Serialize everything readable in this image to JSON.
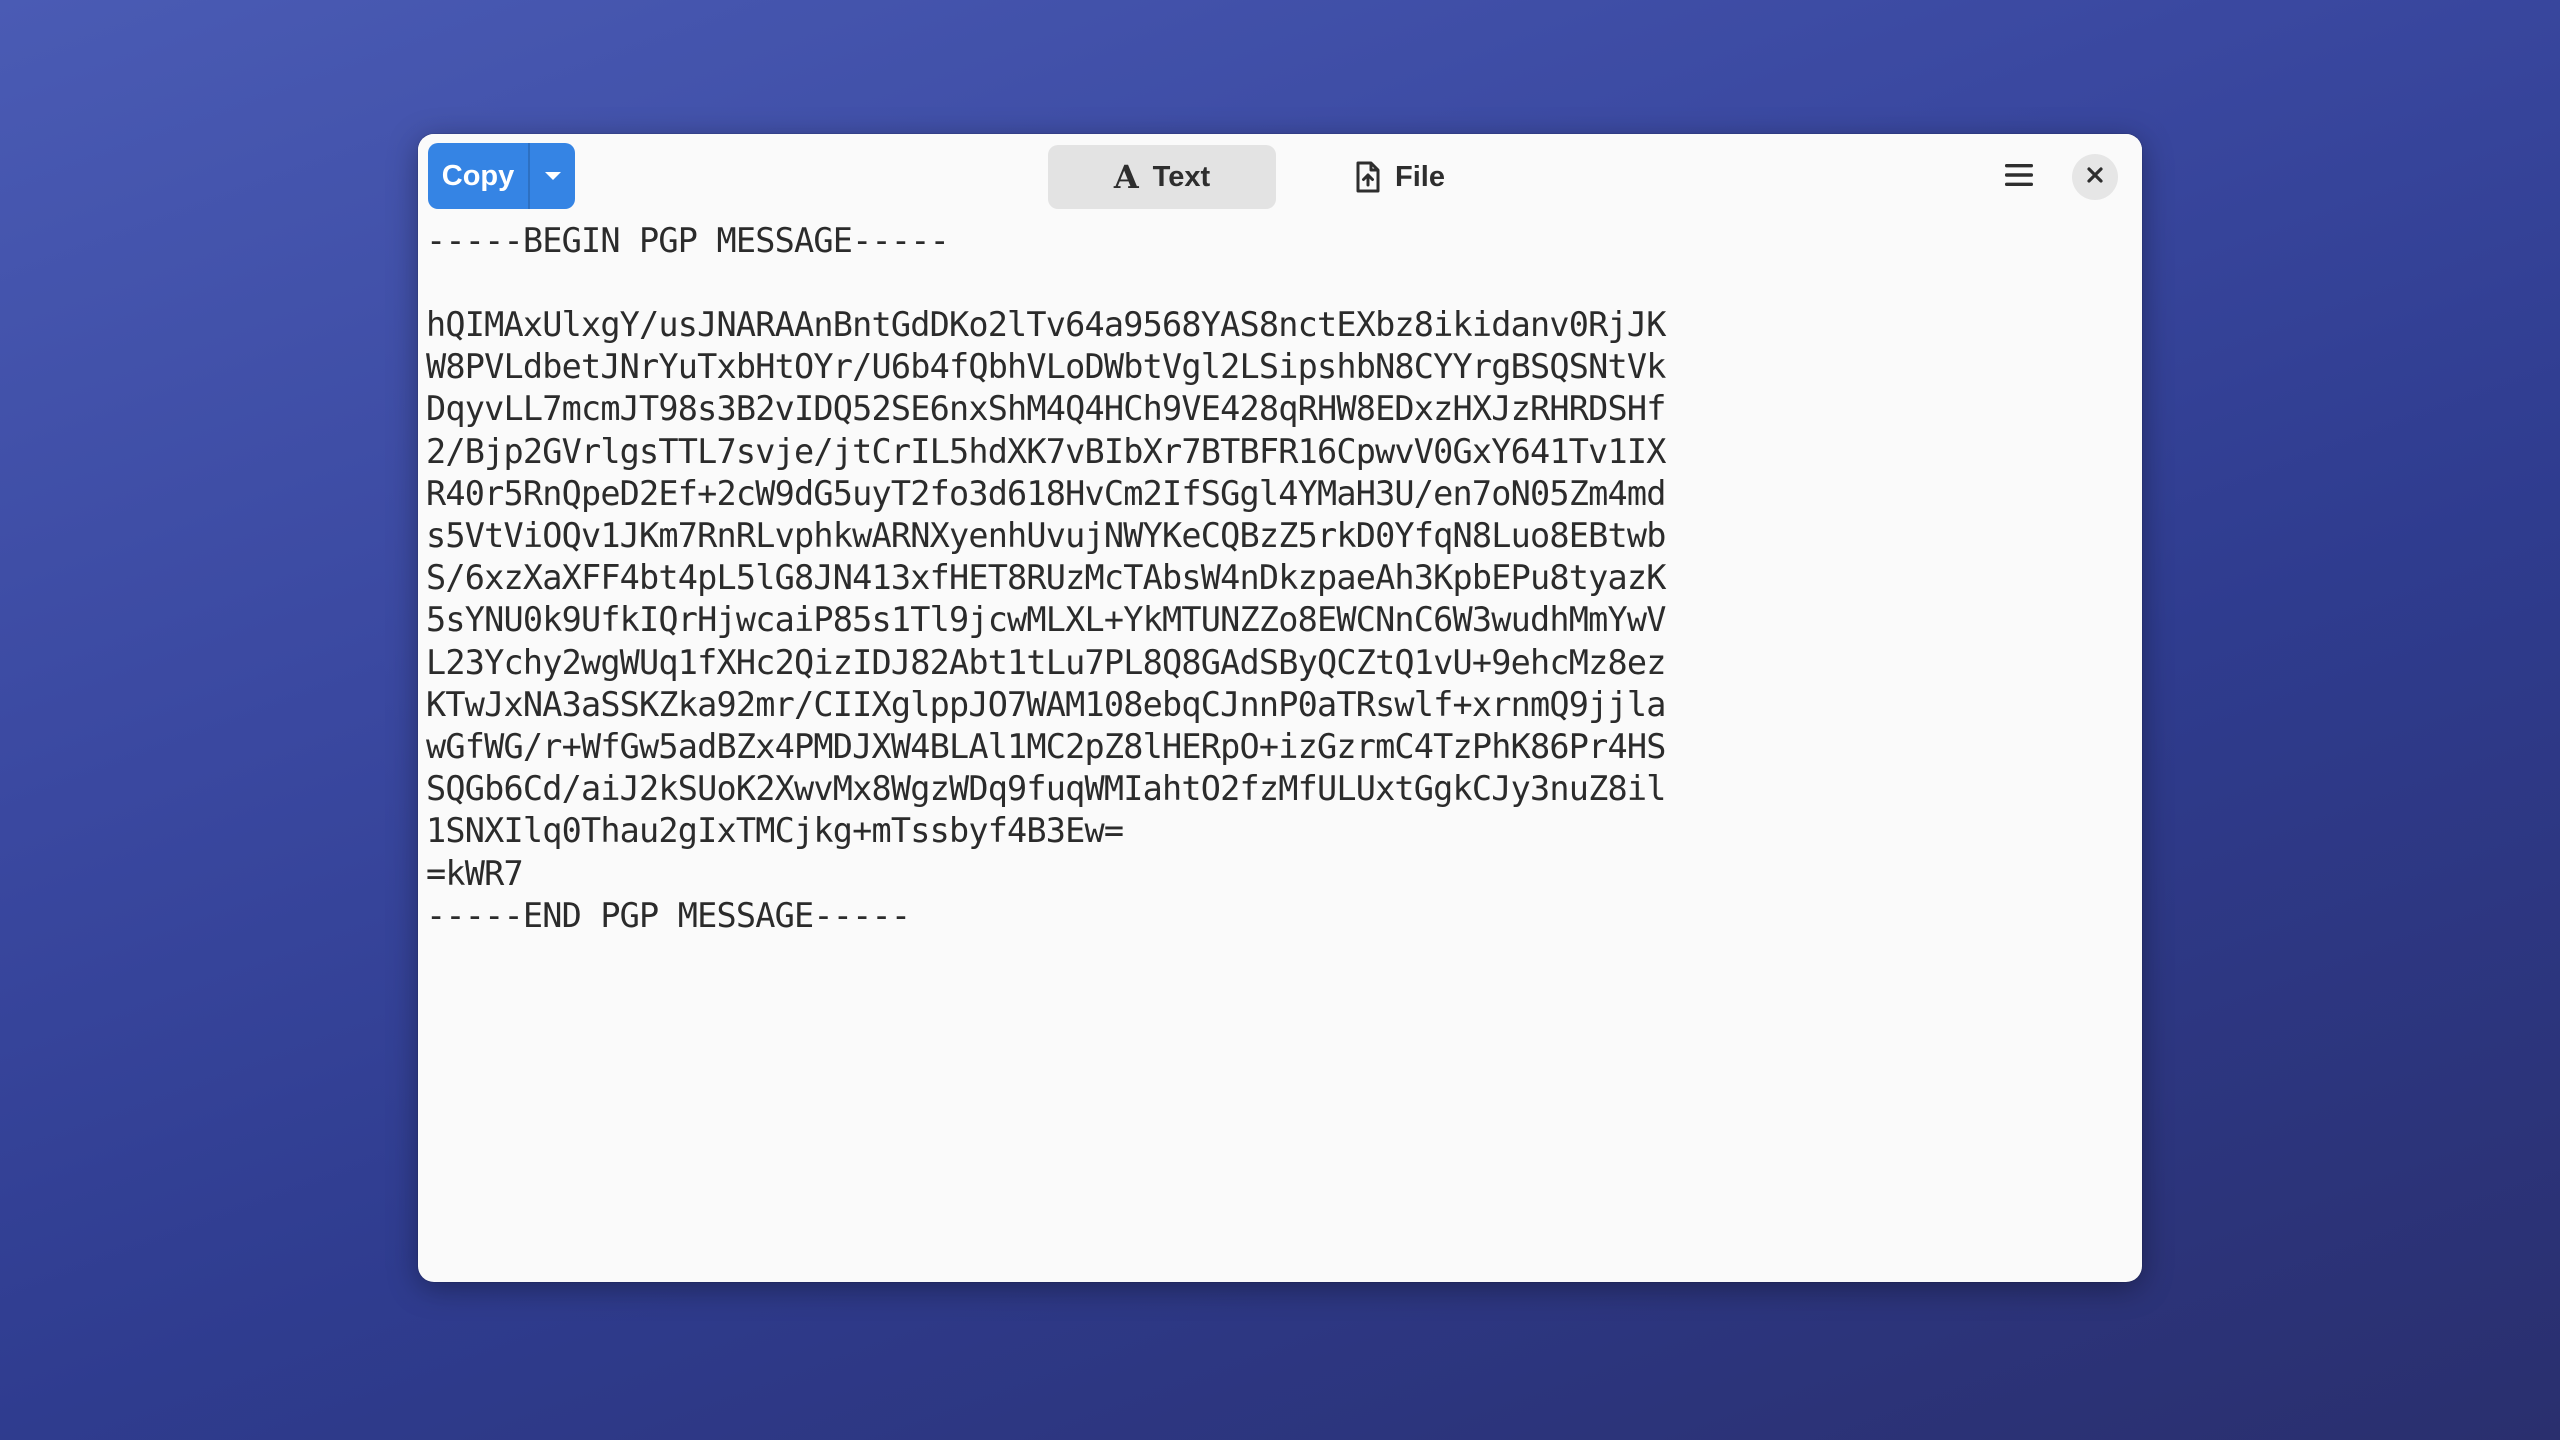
{
  "toolbar": {
    "copy_label": "Copy",
    "modes": [
      {
        "label": "Text",
        "icon": "text-format-icon",
        "active": true
      },
      {
        "label": "File",
        "icon": "document-icon",
        "active": false
      }
    ]
  },
  "message": {
    "header": "-----BEGIN PGP MESSAGE-----",
    "body_lines": [
      "hQIMAxUlxgY/usJNARAAnBntGdDKo2lTv64a9568YAS8nctEXbz8ikidanv0RjJK",
      "W8PVLdbetJNrYuTxbHtOYr/U6b4fQbhVLoDWbtVgl2LSipshbN8CYYrgBSQSNtVk",
      "DqyvLL7mcmJT98s3B2vIDQ52SE6nxShM4Q4HCh9VE428qRHW8EDxzHXJzRHRDSHf",
      "2/Bjp2GVrlgsTTL7svje/jtCrIL5hdXK7vBIbXr7BTBFR16CpwvV0GxY641Tv1IX",
      "R40r5RnQpeD2Ef+2cW9dG5uyT2fo3d618HvCm2IfSGgl4YMaH3U/en7oN05Zm4md",
      "s5VtViOQv1JKm7RnRLvphkwARNXyenhUvujNWYKeCQBzZ5rkD0YfqN8Luo8EBtwb",
      "S/6xzXaXFF4bt4pL5lG8JN413xfHET8RUzMcTAbsW4nDkzpaeAh3KpbEPu8tyazK",
      "5sYNU0k9UfkIQrHjwcaiP85s1Tl9jcwMLXL+YkMTUNZZo8EWCNnC6W3wudhMmYwV",
      "L23Ychy2wgWUq1fXHc2QizIDJ82Abt1tLu7PL8Q8GAdSByQCZtQ1vU+9ehcMz8ez",
      "KTwJxNA3aSSKZka92mr/CIIXglppJO7WAM108ebqCJnnP0aTRswlf+xrnmQ9jjla",
      "wGfWG/r+WfGw5adBZx4PMDJXW4BLAl1MC2pZ8lHERpO+izGzrmC4TzPhK86Pr4HS",
      "SQGb6Cd/aiJ2kSUoK2XwvMx8WgzWDq9fuqWMIahtO2fzMfULUxtGgkCJy3nuZ8il",
      "1SNXIlq0Thau2gIxTMCjkg+mTssbyf4B3Ew="
    ],
    "checksum": "=kWR7",
    "footer": "-----END PGP MESSAGE-----"
  }
}
